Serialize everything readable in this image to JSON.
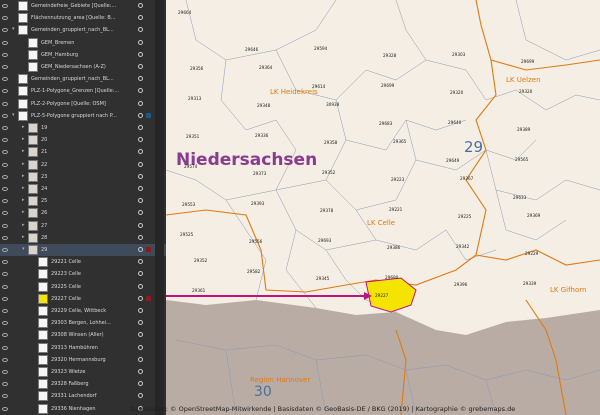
{
  "layers": [
    {
      "label": "Gemeindefreie_Gebiete [Quelle:...",
      "indent": 0,
      "thumb": "white",
      "twisty": ""
    },
    {
      "label": "Flächennutzung_area [Quelle: B...",
      "indent": 0,
      "thumb": "white",
      "twisty": ""
    },
    {
      "label": "Gemeinden_gruppiert_nach_BL...",
      "indent": 0,
      "thumb": "white",
      "twisty": "▾"
    },
    {
      "label": "GEM_Bremen",
      "indent": 1,
      "thumb": "white",
      "twisty": ""
    },
    {
      "label": "GEM_Hamburg",
      "indent": 1,
      "thumb": "white",
      "twisty": ""
    },
    {
      "label": "GEM_Niedersachsen (A-Z)",
      "indent": 1,
      "thumb": "white",
      "twisty": ""
    },
    {
      "label": "Gemeinden_gruppiert_nach_BL...",
      "indent": 0,
      "thumb": "white",
      "twisty": ""
    },
    {
      "label": "PLZ-1-Polygone_Grenzen [Quelle:...",
      "indent": 0,
      "thumb": "white",
      "twisty": ""
    },
    {
      "label": "PLZ-2-Polygone [Quelle: OSM]",
      "indent": 0,
      "thumb": "white",
      "twisty": ""
    },
    {
      "label": "PLZ-5-Polygone gruppiert nach P...",
      "indent": 0,
      "thumb": "white",
      "twisty": "▾",
      "mark": "blue"
    },
    {
      "label": "19",
      "indent": 1,
      "thumb": "map",
      "twisty": "▸"
    },
    {
      "label": "20",
      "indent": 1,
      "thumb": "map",
      "twisty": "▸"
    },
    {
      "label": "21",
      "indent": 1,
      "thumb": "map",
      "twisty": "▸"
    },
    {
      "label": "22",
      "indent": 1,
      "thumb": "map",
      "twisty": "▸"
    },
    {
      "label": "23",
      "indent": 1,
      "thumb": "map",
      "twisty": "▸"
    },
    {
      "label": "24",
      "indent": 1,
      "thumb": "map",
      "twisty": "▸"
    },
    {
      "label": "25",
      "indent": 1,
      "thumb": "map",
      "twisty": "▸"
    },
    {
      "label": "26",
      "indent": 1,
      "thumb": "map",
      "twisty": "▸"
    },
    {
      "label": "27",
      "indent": 1,
      "thumb": "map",
      "twisty": "▸"
    },
    {
      "label": "28",
      "indent": 1,
      "thumb": "map",
      "twisty": "▸"
    },
    {
      "label": "29",
      "indent": 1,
      "thumb": "map",
      "twisty": "▾",
      "selected": true,
      "mark": "red"
    },
    {
      "label": "29221 Celle",
      "indent": 2,
      "thumb": "white",
      "twisty": ""
    },
    {
      "label": "29223 Celle",
      "indent": 2,
      "thumb": "white",
      "twisty": ""
    },
    {
      "label": "29225 Celle",
      "indent": 2,
      "thumb": "white",
      "twisty": ""
    },
    {
      "label": "29227 Celle",
      "indent": 2,
      "thumb": "yellow",
      "twisty": "",
      "mark": "red"
    },
    {
      "label": "29229 Celle, Wittbeck",
      "indent": 2,
      "thumb": "white",
      "twisty": ""
    },
    {
      "label": "29303 Bergen, Lohhei...",
      "indent": 2,
      "thumb": "white",
      "twisty": ""
    },
    {
      "label": "29308 Winsen (Aller)",
      "indent": 2,
      "thumb": "white",
      "twisty": ""
    },
    {
      "label": "29313 Hambühren",
      "indent": 2,
      "thumb": "white",
      "twisty": ""
    },
    {
      "label": "29320 Hermannsburg",
      "indent": 2,
      "thumb": "white",
      "twisty": ""
    },
    {
      "label": "29323 Wietze",
      "indent": 2,
      "thumb": "white",
      "twisty": ""
    },
    {
      "label": "29328 Faßberg",
      "indent": 2,
      "thumb": "white",
      "twisty": ""
    },
    {
      "label": "29331 Lachendorf",
      "indent": 2,
      "thumb": "white",
      "twisty": ""
    },
    {
      "label": "29336 Nienhagen",
      "indent": 2,
      "thumb": "white",
      "twisty": ""
    }
  ],
  "map": {
    "state_label": "Niedersachsen",
    "region_label": "29",
    "region_label_2": "30",
    "lk_labels": [
      "LK Heidekreis",
      "LK Uelzen",
      "LK Celle",
      "LK Gifhorn",
      "Region Hannover"
    ],
    "highlight_code": "29227",
    "codes": [
      "29664",
      "29646",
      "29614",
      "29683",
      "29649",
      "29633",
      "29525",
      "29582",
      "29594",
      "29699",
      "29640",
      "29565",
      "29553",
      "29556",
      "29345",
      "29328",
      "29320",
      "29389",
      "29574",
      "29393",
      "29693",
      "29690",
      "29303",
      "29320",
      "29351",
      "29373",
      "29378",
      "29386",
      "29396",
      "29699",
      "29313",
      "29336",
      "29352",
      "29221",
      "29342",
      "29339",
      "29356",
      "29348",
      "29358",
      "29223",
      "29225",
      "29229",
      "29361",
      "29364",
      "30938",
      "29365",
      "29367",
      "29369",
      "29352"
    ],
    "colors": {
      "highlight": "#f5e400",
      "arrow": "#c0137a",
      "lk": "#e07a10",
      "bg": "#f4eee4",
      "outside": "#b9aca5",
      "region": "#4a6ea0",
      "state": "#8a3a8f"
    }
  },
  "footer": "Basisdaten: © OpenStreetMap-Mitwirkende | Basisdaten © GeoBasis-DE / BKG (2019) | Kartographie © grebemaps.de"
}
